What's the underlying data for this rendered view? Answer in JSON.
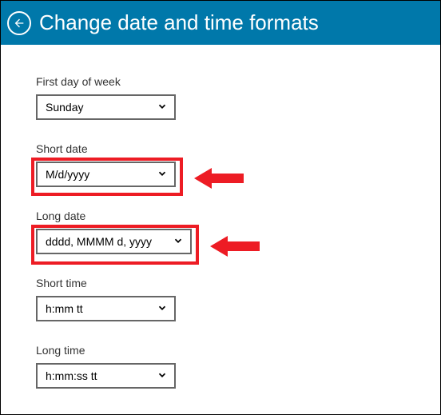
{
  "header": {
    "title": "Change date and time formats"
  },
  "fields": {
    "firstDay": {
      "label": "First day of week",
      "value": "Sunday"
    },
    "shortDate": {
      "label": "Short date",
      "value": "M/d/yyyy"
    },
    "longDate": {
      "label": "Long date",
      "value": "dddd, MMMM d, yyyy"
    },
    "shortTime": {
      "label": "Short time",
      "value": "h:mm tt"
    },
    "longTime": {
      "label": "Long time",
      "value": "h:mm:ss tt"
    }
  }
}
